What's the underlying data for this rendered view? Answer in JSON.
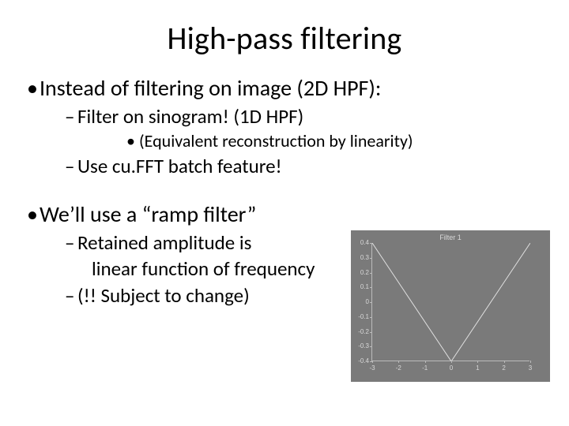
{
  "title": "High-pass filtering",
  "bullets": {
    "b1": "Instead of filtering on image (2D HPF):",
    "b1a": "Filter on sinogram! (1D HPF)",
    "b1a_i": "(Equivalent reconstruction by linearity)",
    "b1b": "Use cu.FFT batch feature!",
    "b2": "We’ll use a “ramp filter”",
    "b2a": "Retained amplitude is",
    "b2a_cont": "linear function of frequency",
    "b2b": "(!! Subject to change)"
  },
  "chart_data": {
    "type": "line",
    "title": "Filter 1",
    "x": [
      -3,
      0,
      3
    ],
    "y": [
      0.4,
      -0.4,
      0.4
    ],
    "xlim": [
      -3,
      3
    ],
    "ylim": [
      -0.4,
      0.4
    ],
    "xticks": [
      -3,
      -2,
      -1,
      0,
      1,
      2,
      3
    ],
    "yticks": [
      -0.4,
      -0.3,
      -0.2,
      -0.1,
      0,
      0.1,
      0.2,
      0.3,
      0.4
    ],
    "xlabel": "",
    "ylabel": ""
  }
}
